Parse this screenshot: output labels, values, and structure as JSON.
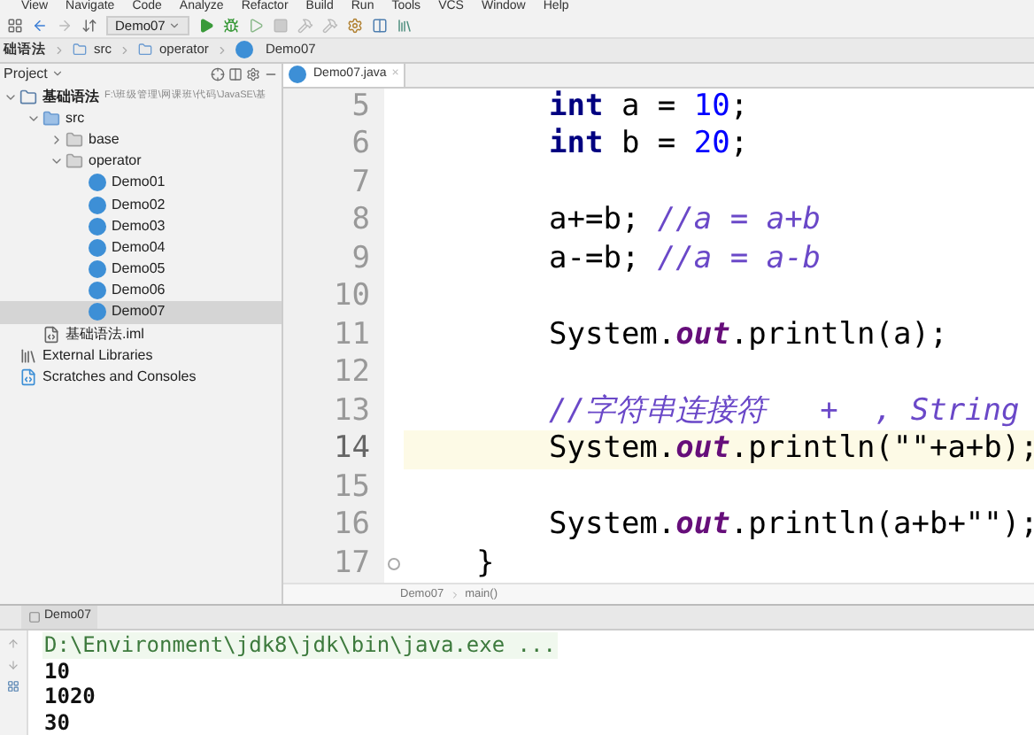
{
  "menu": [
    "View",
    "Navigate",
    "Code",
    "Analyze",
    "Refactor",
    "Build",
    "Run",
    "Tools",
    "VCS",
    "Window",
    "Help"
  ],
  "toolbar": {
    "run_config": "Demo07"
  },
  "breadcrumb": [
    "础语法",
    "src",
    "operator",
    "Demo07"
  ],
  "project_panel": {
    "title": "Project",
    "tree": [
      {
        "label": "基础语法",
        "path": "F:\\班级管理\\网课班\\代码\\JavaSE\\基",
        "kind": "module",
        "selected": false,
        "expanded": true,
        "children": [
          {
            "label": "src",
            "kind": "folder",
            "selected": false,
            "expanded": true,
            "children": [
              {
                "label": "base",
                "kind": "package",
                "selected": false,
                "expanded": false
              },
              {
                "label": "operator",
                "kind": "package",
                "selected": false,
                "expanded": true,
                "children": [
                  {
                    "label": "Demo01",
                    "kind": "class",
                    "selected": false
                  },
                  {
                    "label": "Demo02",
                    "kind": "class",
                    "selected": false
                  },
                  {
                    "label": "Demo03",
                    "kind": "class",
                    "selected": false
                  },
                  {
                    "label": "Demo04",
                    "kind": "class",
                    "selected": false
                  },
                  {
                    "label": "Demo05",
                    "kind": "class",
                    "selected": false
                  },
                  {
                    "label": "Demo06",
                    "kind": "class",
                    "selected": false
                  },
                  {
                    "label": "Demo07",
                    "kind": "class",
                    "selected": true
                  }
                ]
              }
            ]
          },
          {
            "label": "基础语法.iml",
            "kind": "file",
            "selected": false
          }
        ]
      },
      {
        "label": "External Libraries",
        "kind": "library",
        "selected": false
      },
      {
        "label": "Scratches and Consoles",
        "kind": "scratch",
        "selected": false
      }
    ]
  },
  "editor": {
    "tabs": [
      {
        "label": "Demo07.java",
        "close": "×",
        "selected": true
      }
    ],
    "lines": [
      {
        "number": "5",
        "kind": "body",
        "current": false,
        "tokens": [
          {
            "kind": "keyword",
            "text": "int"
          },
          {
            "kind": "plain",
            "text": " a = "
          },
          {
            "kind": "number",
            "text": "10"
          },
          {
            "kind": "plain",
            "text": ";"
          }
        ]
      },
      {
        "number": "6",
        "kind": "body",
        "current": false,
        "tokens": [
          {
            "kind": "keyword",
            "text": "int"
          },
          {
            "kind": "plain",
            "text": " b = "
          },
          {
            "kind": "number",
            "text": "20"
          },
          {
            "kind": "plain",
            "text": ";"
          }
        ]
      },
      {
        "number": "7",
        "kind": "blank",
        "current": false
      },
      {
        "number": "8",
        "kind": "body",
        "current": false,
        "tokens": [
          {
            "kind": "plain",
            "text": "a+=b; "
          },
          {
            "kind": "comment",
            "text": "//a = a+b"
          }
        ]
      },
      {
        "number": "9",
        "kind": "body",
        "current": false,
        "tokens": [
          {
            "kind": "plain",
            "text": "a-=b; "
          },
          {
            "kind": "comment",
            "text": "//a = a-b"
          }
        ]
      },
      {
        "number": "10",
        "kind": "blank",
        "current": false
      },
      {
        "number": "11",
        "kind": "body",
        "current": false,
        "tokens": [
          {
            "kind": "plain",
            "text": "System."
          },
          {
            "kind": "field",
            "text": "out"
          },
          {
            "kind": "plain",
            "text": ".println(a);"
          }
        ]
      },
      {
        "number": "12",
        "kind": "blank",
        "current": false
      },
      {
        "number": "13",
        "kind": "body",
        "current": false,
        "tokens": [
          {
            "kind": "comment",
            "text": "//字符串连接符   +  , String"
          }
        ]
      },
      {
        "number": "14",
        "kind": "body",
        "current": true,
        "tokens": [
          {
            "kind": "plain",
            "text": "System."
          },
          {
            "kind": "field",
            "text": "out"
          },
          {
            "kind": "plain",
            "text": ".println(\"\"+a+b);"
          }
        ]
      },
      {
        "number": "15",
        "kind": "blank",
        "current": false
      },
      {
        "number": "16",
        "kind": "body",
        "current": false,
        "tokens": [
          {
            "kind": "plain",
            "text": "System."
          },
          {
            "kind": "field",
            "text": "out"
          },
          {
            "kind": "plain",
            "text": ".println(a+b+\"\");"
          }
        ]
      },
      {
        "number": "17",
        "kind": "close",
        "current": false,
        "tokens": [
          {
            "kind": "plain",
            "text": "}"
          }
        ]
      }
    ],
    "breadcrumb": [
      "Demo07",
      "main()"
    ]
  },
  "run_panel": {
    "tab": "Demo07",
    "output": [
      {
        "kind": "command",
        "text": "D:\\Environment\\jdk8\\jdk\\bin\\java.exe ..."
      },
      {
        "kind": "stdout",
        "text": "10"
      },
      {
        "kind": "stdout",
        "text": "1020"
      },
      {
        "kind": "stdout",
        "text": "30"
      }
    ]
  }
}
